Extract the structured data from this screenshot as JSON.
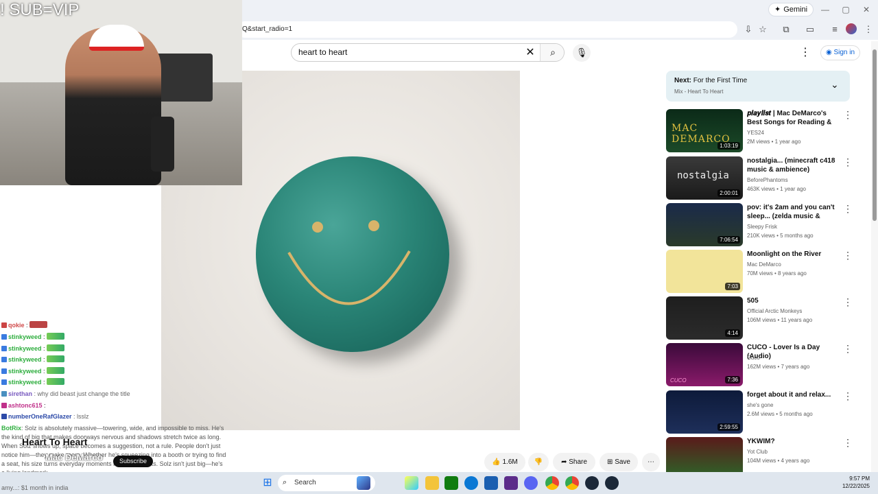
{
  "browser": {
    "gemini_label": "Gemini",
    "url": "Q&start_radio=1",
    "window_controls": [
      "—",
      "▢",
      "✕"
    ]
  },
  "youtube": {
    "search_value": "heart to heart",
    "sign_in": "Sign in",
    "video": {
      "title": "Heart To Heart",
      "channel": "Mac DeMarco",
      "subscribe": "Subscribe",
      "likes": "1.6M",
      "share": "Share",
      "save": "Save"
    },
    "next": {
      "label": "Next:",
      "title": "For the First Time",
      "subtitle": "Mix - Heart To Heart"
    },
    "recommendations": [
      {
        "title_prefix": "𝒑𝒍𝒂𝒚𝒍𝒊𝒔𝒕",
        "title": " | Mac DeMarco's Best Songs for Reading & Work",
        "channel": "YES24",
        "meta": "2M views • 1 year ago",
        "duration": "1:03:19",
        "thumb_text": "MAC DEMARCO"
      },
      {
        "title": "nostalgia... (minecraft c418 music & ambience)",
        "channel": "BeforePhantoms",
        "meta": "463K views • 1 year ago",
        "duration": "2:00:01",
        "thumb_text": "nostalgia"
      },
      {
        "title": "pov: it's 2am and you can't sleep... (zelda music & heavy ...",
        "channel": "Sleepy Frisk",
        "meta": "210K views • 5 months ago",
        "duration": "7:06:54",
        "thumb_text": ""
      },
      {
        "title": "Moonlight on the River",
        "channel": "Mac DeMarco",
        "meta": "70M views • 8 years ago",
        "duration": "7:03",
        "thumb_text": ""
      },
      {
        "title": "505",
        "channel": "Official Arctic Monkeys",
        "meta": "106M views • 11 years ago",
        "duration": "4:14",
        "thumb_text": ""
      },
      {
        "title": "CUCO - Lover Is a Day (Audio)",
        "channel": "Cuco",
        "meta": "162M views • 7 years ago",
        "duration": "7:36",
        "thumb_text": "CUCO"
      },
      {
        "title": "forget about it and relax...",
        "channel": "she's gone",
        "meta": "2.6M views • 5 months ago",
        "duration": "2:59:55",
        "thumb_text": ""
      },
      {
        "title": "YKWIM?",
        "channel": "Yot Club",
        "meta": "104M views • 4 years ago",
        "duration": "",
        "thumb_text": ""
      }
    ]
  },
  "stream": {
    "overlay_text": "! SUB=VIP",
    "chat": [
      {
        "name": "qokie",
        "text": ":",
        "color": "#d04a4a"
      },
      {
        "name": "stinkyweed",
        "text": ":",
        "color": "#2fae3f"
      },
      {
        "name": "stinkyweed",
        "text": ":",
        "color": "#2fae3f"
      },
      {
        "name": "stinkyweed",
        "text": ":",
        "color": "#2fae3f"
      },
      {
        "name": "stinkyweed",
        "text": ":",
        "color": "#2fae3f"
      },
      {
        "name": "stinkyweed",
        "text": ":",
        "color": "#2fae3f"
      },
      {
        "name": "sirethan",
        "text": ": why did beast just change the title",
        "color": "#7a5cc0"
      },
      {
        "name": "ashtonc615",
        "text": ":",
        "color": "#c0308a"
      },
      {
        "name": "numberOneRafGlazer",
        "text": ": lsslz",
        "color": "#2c4aa8"
      }
    ],
    "long_message_name": "BotRix",
    "long_message": ": Solz is absolutely massive—towering, wide, and impossible to miss. He's the kind of big that makes doorways nervous and shadows stretch twice as long. When Solz shows up, space becomes a suggestion, not a rule. People don't just notice him—they make room. Whether he's squeezing into a booth or trying to find a seat, his size turns everyday moments into epic events. Solz isn't just big—he's a living landmark.",
    "last_line": "amy...: $1 month in india"
  },
  "taskbar": {
    "search": "Search",
    "time": "9:57 PM",
    "date": "12/22/2025"
  },
  "colors": {
    "youtube_blue": "#065fd4",
    "smiley_teal": "#2a8577",
    "smiley_gold": "#d8b46a"
  }
}
